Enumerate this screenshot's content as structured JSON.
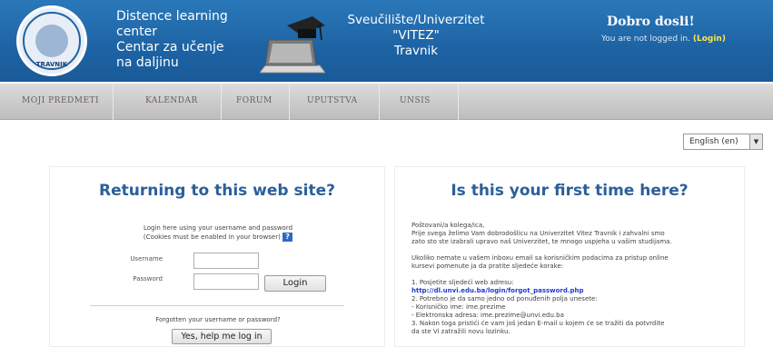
{
  "header": {
    "logo_text": "TRAVNIK",
    "brand_lines": [
      "Distence learning",
      "center",
      "Centar za učenje",
      "na daljinu"
    ],
    "university_lines": [
      "Sveučilište/Univerzitet",
      "\"VITEZ\"",
      "Travnik"
    ],
    "welcome": "Dobro dosli!",
    "login_status": "You are not logged in.",
    "login_link": "(Login)"
  },
  "nav": {
    "tabs": [
      "MOJI PREDMETI",
      "KALENDAR",
      "FORUM",
      "UPUTSTVA",
      "UNSIS"
    ]
  },
  "language": {
    "selected": "English (en)"
  },
  "returning": {
    "title": "Returning to this web site?",
    "instructions": [
      "Login here using your username and password",
      "(Cookies must be enabled in your browser)"
    ],
    "username_label": "Username",
    "password_label": "Password",
    "login_button": "Login",
    "forgot_text": "Forgotten your username or password?",
    "help_button": "Yes, help me log in"
  },
  "first_time": {
    "title": "Is this your first time here?",
    "lines": [
      "Poštovani/a kolega/ica,",
      "Prije svega želimo Vam dobrodošlicu na Univerzitet Vitez Travnik i zahvalni smo",
      "zato sto ste izabrali upravo naš Univerzitet, te mnogo uspjeha u vašim studijama.",
      "",
      "Ukoliko nemate u vašem inboxu email sa korisničkim podacima za pristup online",
      "kursevi pomenute ja da pratite sljedeće korake:",
      "",
      "1. Posjetite sljedeći web adresu:"
    ],
    "link": "http://dl.unvi.edu.ba/login/forgot_password.php",
    "lines2": [
      "2. Potrebno je da samo jedno od ponuđenih polja unesete:",
      "  - Korisničko ime: ime.prezime",
      "  - Elektronska adresa: ime.prezime@unvi.edu.ba",
      "3. Nakon toga pristići će vam još jedan E-mail u kojem će se tražiti da potvrdite",
      "da ste Vi zatražili novu lozinku."
    ]
  }
}
